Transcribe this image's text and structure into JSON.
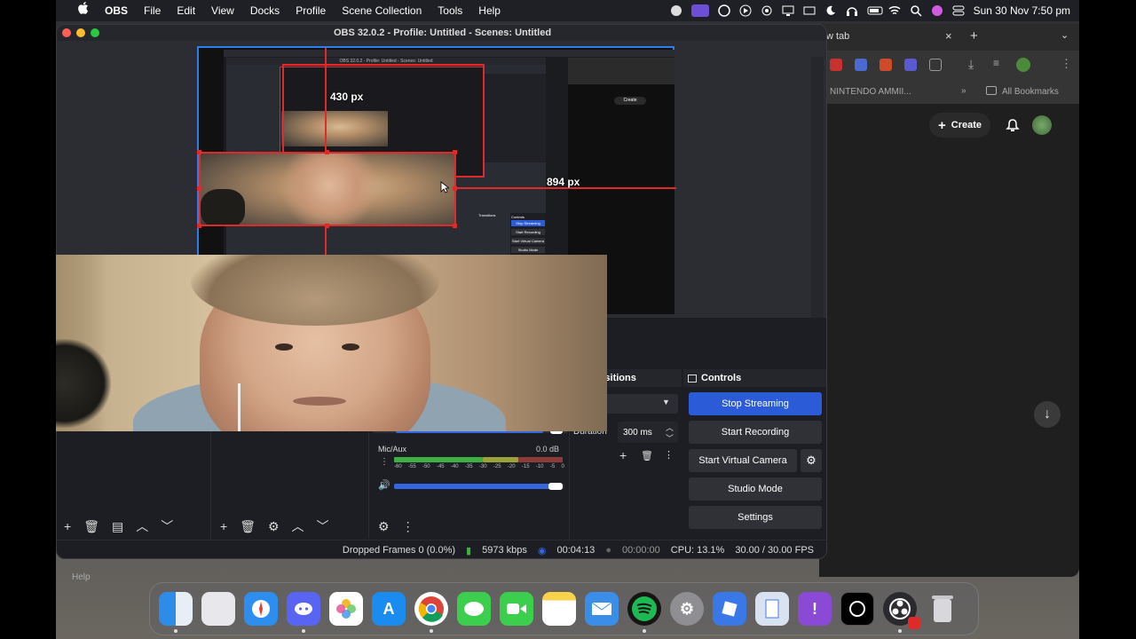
{
  "menubar": {
    "app_name": "OBS",
    "items": [
      "File",
      "Edit",
      "View",
      "Docks",
      "Profile",
      "Scene Collection",
      "Tools",
      "Help"
    ],
    "clock": "Sun 30 Nov  7:50 pm"
  },
  "obs": {
    "title": "OBS 32.0.2 - Profile: Untitled - Scenes: Untitled",
    "nested_title": "OBS 32.0.2 - Profile: Untitled - Scenes: Untitled",
    "measure_vertical": "430 px",
    "measure_horizontal": "894 px",
    "transitions_header": "e Transitions",
    "controls_header": "Controls",
    "duration_label": "Duration",
    "duration_value": "300 ms",
    "controls": {
      "stop_streaming": "Stop Streaming",
      "start_recording": "Start Recording",
      "start_virtual_camera": "Start Virtual Camera",
      "studio_mode": "Studio Mode",
      "settings": "Settings"
    },
    "mixer": {
      "channel_name": "Mic/Aux",
      "channel_db": "0.0 dB",
      "ticks": [
        "-60",
        "-55",
        "-50",
        "-45",
        "-40",
        "-35",
        "-30",
        "-25",
        "-20",
        "-15",
        "-10",
        "-5",
        "0"
      ]
    },
    "nested_controls": {
      "stop_streaming": "Stop Streaming",
      "start_recording": "Start Recording",
      "start_virtual_camera": "Start Virtual Camera",
      "studio_mode": "Studio Mode",
      "controls": "Controls",
      "transitions": "Transitions",
      "create": "Create"
    },
    "status": {
      "dropped_frames": "Dropped Frames 0 (0.0%)",
      "bitrate": "5973 kbps",
      "stream_time": "00:04:13",
      "record_time": "00:00:00",
      "cpu": "CPU: 13.1%",
      "fps": "30.00 / 30.00 FPS"
    }
  },
  "chrome": {
    "tab_title": "w tab",
    "bookmark_item": "NINTENDO AMMII...",
    "all_bookmarks": "All Bookmarks",
    "create_label": "Create"
  },
  "ghost_help": "Help",
  "dock_apps": [
    "finder",
    "launchpad",
    "safari",
    "discord",
    "photos",
    "app-store",
    "chrome",
    "messages",
    "facetime",
    "notes",
    "mail",
    "spotify",
    "system-settings",
    "roblox",
    "preview",
    "feedback",
    "chatgpt",
    "obs",
    "trash"
  ],
  "colors": {
    "accent_blue": "#2c5bd8",
    "selection_red": "#e02a2a",
    "canvas_border": "#2f7bf0"
  }
}
